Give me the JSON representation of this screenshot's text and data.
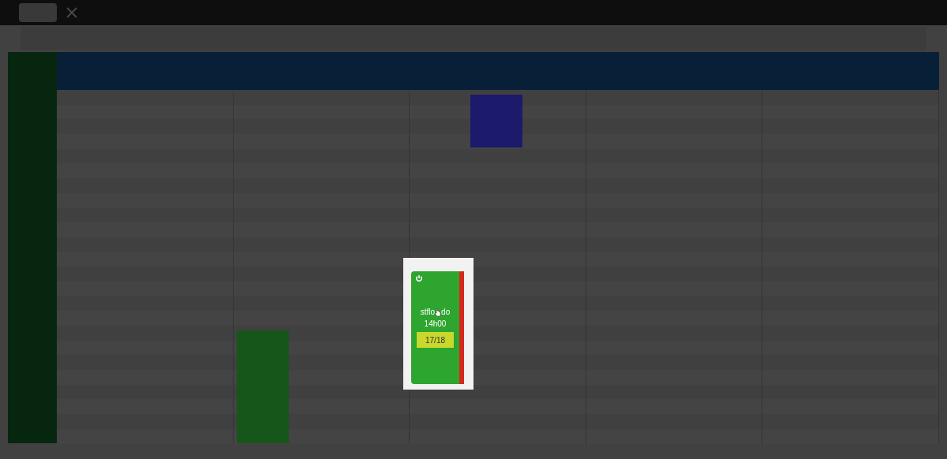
{
  "highlighted_card": {
    "title_start": "stflo",
    "title_end": "do",
    "time": "14h00",
    "count": "17/18",
    "full": true
  }
}
